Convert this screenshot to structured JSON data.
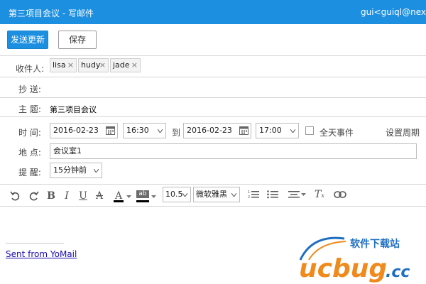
{
  "window": {
    "title": "第三项目会议 - 写邮件",
    "account": "gui<guiql@nexted"
  },
  "toolbar": {
    "send_label": "发送更新",
    "save_label": "保存"
  },
  "recipients": {
    "to_label": "收件人:",
    "to": [
      "lisa",
      "hudy",
      "jade"
    ],
    "cc_label": "抄 送:"
  },
  "subject": {
    "label": "主 题:",
    "value": "第三项目会议"
  },
  "time": {
    "label": "时 间:",
    "start_date": "2016-02-23",
    "start_time": "16:30",
    "to_label": "到",
    "end_date": "2016-02-23",
    "end_time": "17:00",
    "all_day_label": "全天事件",
    "recurrence_label": "设置周期"
  },
  "location": {
    "label": "地 点:",
    "value": "会议室1"
  },
  "reminder": {
    "label": "提 醒:",
    "value": "15分钟前"
  },
  "editor": {
    "font_size": "10.5",
    "font_family": "微软雅黑",
    "bold": "B",
    "italic": "I",
    "underline": "U",
    "strike": "A",
    "font_color": "A",
    "highlight": "ab",
    "clear_format": "T"
  },
  "signature": {
    "link_text": "Sent from YoMail"
  },
  "watermark": {
    "text_cn": "软件下载站",
    "text_logo": "ucbug",
    "text_tld": ".cc"
  },
  "colors": {
    "accent": "#1d8fe0",
    "link": "#1a0dab",
    "watermark_orange": "#f08a1c",
    "watermark_blue": "#1f6fc0"
  }
}
